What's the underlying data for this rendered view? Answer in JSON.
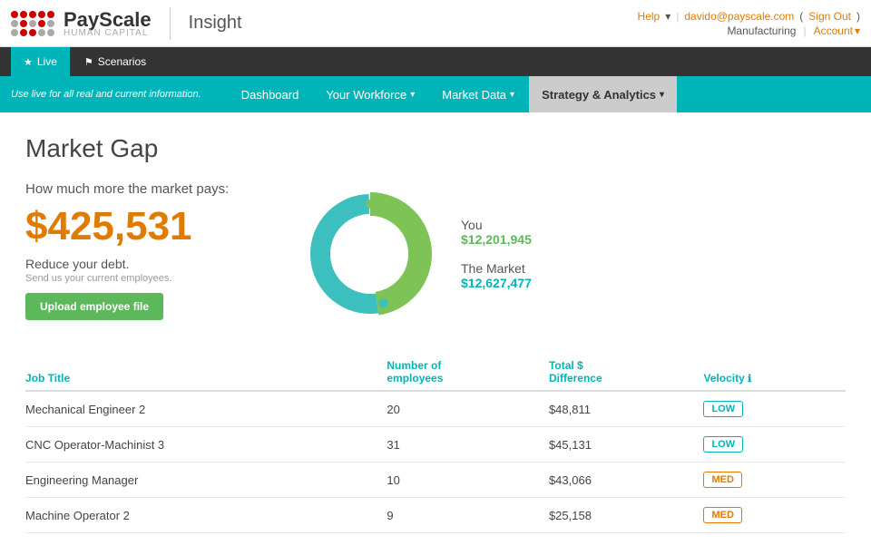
{
  "app": {
    "logo_name": "PayScale",
    "logo_subtitle": "HUMAN CAPITAL",
    "product_name": "Insight"
  },
  "topbar": {
    "help_label": "Help",
    "user_email": "davido@payscale.com",
    "signout_label": "Sign Out",
    "company_label": "Manufacturing",
    "account_label": "Account"
  },
  "tabs": [
    {
      "label": "Live",
      "icon": "★",
      "active": true
    },
    {
      "label": "Scenarios",
      "icon": "👤",
      "active": false
    }
  ],
  "navbar": {
    "info_text": "Use live for all real and current information.",
    "links": [
      {
        "label": "Dashboard",
        "active": false,
        "has_arrow": false
      },
      {
        "label": "Your Workforce",
        "active": false,
        "has_arrow": true
      },
      {
        "label": "Market Data",
        "active": false,
        "has_arrow": true
      },
      {
        "label": "Strategy & Analytics",
        "active": true,
        "has_arrow": true
      }
    ]
  },
  "page": {
    "title": "Market Gap",
    "how_much_label": "How much more the market pays:",
    "big_amount": "$425,531",
    "reduce_label": "Reduce your debt.",
    "send_label": "Send us your current employees.",
    "upload_button": "Upload employee file",
    "you_label": "You",
    "you_value": "$12,201,945",
    "market_label": "The Market",
    "market_value": "$12,627,477",
    "info_icon": "ℹ"
  },
  "table": {
    "columns": [
      {
        "label": "Job Title"
      },
      {
        "label": "Number of employees"
      },
      {
        "label": "Total $ Difference"
      },
      {
        "label": "Velocity"
      }
    ],
    "rows": [
      {
        "title": "Mechanical Engineer 2",
        "employees": "20",
        "difference": "$48,811",
        "velocity": "LOW",
        "velocity_type": "low"
      },
      {
        "title": "CNC Operator-Machinist 3",
        "employees": "31",
        "difference": "$45,131",
        "velocity": "LOW",
        "velocity_type": "low"
      },
      {
        "title": "Engineering Manager",
        "employees": "10",
        "difference": "$43,066",
        "velocity": "MED",
        "velocity_type": "med"
      },
      {
        "title": "Machine Operator 2",
        "employees": "9",
        "difference": "$25,158",
        "velocity": "MED",
        "velocity_type": "med"
      }
    ]
  },
  "chart": {
    "you_percent": 48,
    "market_percent": 52,
    "you_color": "#7dc355",
    "market_color": "#3bbfbf"
  }
}
